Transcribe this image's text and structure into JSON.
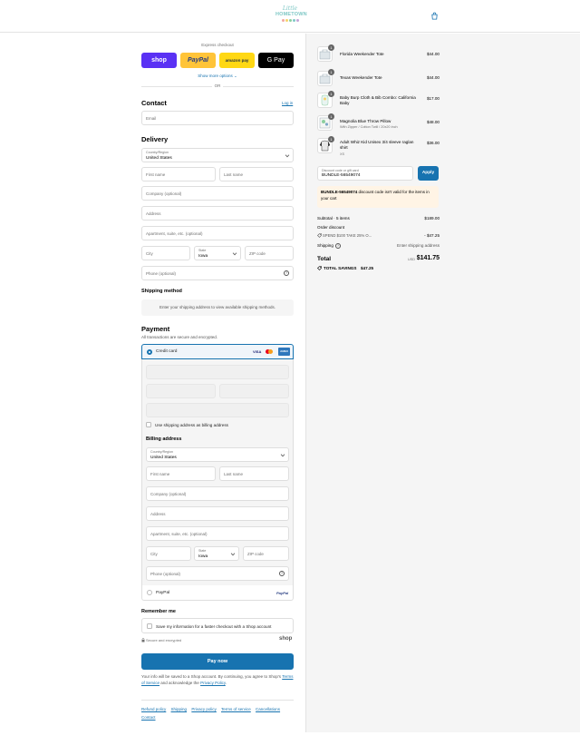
{
  "header": {
    "logo_line1": "Little",
    "logo_line2": "HOMETOWN",
    "logo_dot_colors": [
      "#f2a7a0",
      "#f6d36b",
      "#8ccf9f",
      "#7fc8c6",
      "#c3a4d8"
    ]
  },
  "express": {
    "title": "Express checkout",
    "buttons": [
      {
        "label": "shop",
        "bg": "#5a31f4",
        "fg": "#ffffff"
      },
      {
        "label": "PayPal",
        "bg": "#ffc439",
        "fg": "#253b80"
      },
      {
        "label": "amazon pay",
        "bg": "#ffd814",
        "fg": "#232f3e"
      },
      {
        "label": "G Pay",
        "bg": "#000000",
        "fg": "#ffffff"
      }
    ],
    "show_more": "Show more options",
    "or": "OR"
  },
  "contact": {
    "title": "Contact",
    "login": "Log in",
    "email_placeholder": "Email"
  },
  "delivery": {
    "title": "Delivery",
    "country_label": "Country/Region",
    "country_value": "United States",
    "first_name": "First name",
    "last_name": "Last name",
    "company": "Company (optional)",
    "address": "Address",
    "apartment": "Apartment, suite, etc. (optional)",
    "city": "City",
    "state_label": "State",
    "state_value": "Iowa",
    "zip": "ZIP code",
    "phone": "Phone (optional)"
  },
  "shipping_method": {
    "title": "Shipping method",
    "message": "Enter your shipping address to view available shipping methods."
  },
  "payment": {
    "title": "Payment",
    "subtitle": "All transactions are secure and encrypted.",
    "credit_card": "Credit card",
    "card_brands": [
      "VISA",
      "MC",
      "AMEX"
    ],
    "use_shipping": "Use shipping address as billing address",
    "paypal": "PayPal",
    "paypal_logo": "PayPal"
  },
  "billing": {
    "title": "Billing address",
    "country_label": "Country/Region",
    "country_value": "United States",
    "first_name": "First name",
    "last_name": "Last name",
    "company": "Company (optional)",
    "address": "Address",
    "apartment": "Apartment, suite, etc. (optional)",
    "city": "City",
    "state_label": "State",
    "state_value": "Iowa",
    "zip": "ZIP code",
    "phone": "Phone (optional)"
  },
  "remember": {
    "title": "Remember me",
    "save_info": "Save my information for a faster checkout with a Shop account",
    "secure": "Secure and encrypted",
    "shop_logo": "shop"
  },
  "pay_now": "Pay now",
  "legal": {
    "line1": "Your info will be saved to a Shop account. By continuing, you agree to Shop's",
    "tos": "Terms of Service",
    "and_ack": "and acknowledge the",
    "privacy": "Privacy Policy",
    "period": "."
  },
  "footer_links": [
    "Refund policy",
    "Shipping",
    "Privacy policy",
    "Terms of service",
    "Cancellations",
    "Contact"
  ],
  "cart": {
    "items": [
      {
        "qty": "1",
        "name": "Florida Weekender Tote",
        "sub": "",
        "price": "$44.00"
      },
      {
        "qty": "1",
        "name": "Texas Weekender Tote",
        "sub": "",
        "price": "$44.00"
      },
      {
        "qty": "1",
        "name": "Baby Burp Cloth & Bib Combo: California Baby",
        "sub": "",
        "price": "$17.00"
      },
      {
        "qty": "1",
        "name": "Magnolia Blue Throw Pillow",
        "sub": "With Zipper / Cotton Twill / 20x20 inch",
        "price": "$48.00"
      },
      {
        "qty": "1",
        "name": "Adult Whiz Kid Unisex 3/4 sleeve raglan shirt",
        "sub": "XS",
        "price": "$36.00"
      }
    ],
    "discount_label": "Discount code or gift card",
    "discount_value": "BUNDLE-56549074",
    "apply": "Apply",
    "warning_code": "BUNDLE-56549074",
    "warning_text": "discount code isn't valid for the items in your cart",
    "subtotal_label": "Subtotal · 5 items",
    "subtotal_value": "$189.00",
    "order_discount": "Order discount",
    "discount_tag": "SPEND $100 TAKE 25% O...",
    "discount_amount": "- $47.25",
    "shipping_label": "Shipping",
    "shipping_value": "Enter shipping address",
    "total_label": "Total",
    "currency": "USD",
    "total_value": "$141.75",
    "savings_label": "TOTAL SAVINGS",
    "savings_value": "$47.25"
  }
}
